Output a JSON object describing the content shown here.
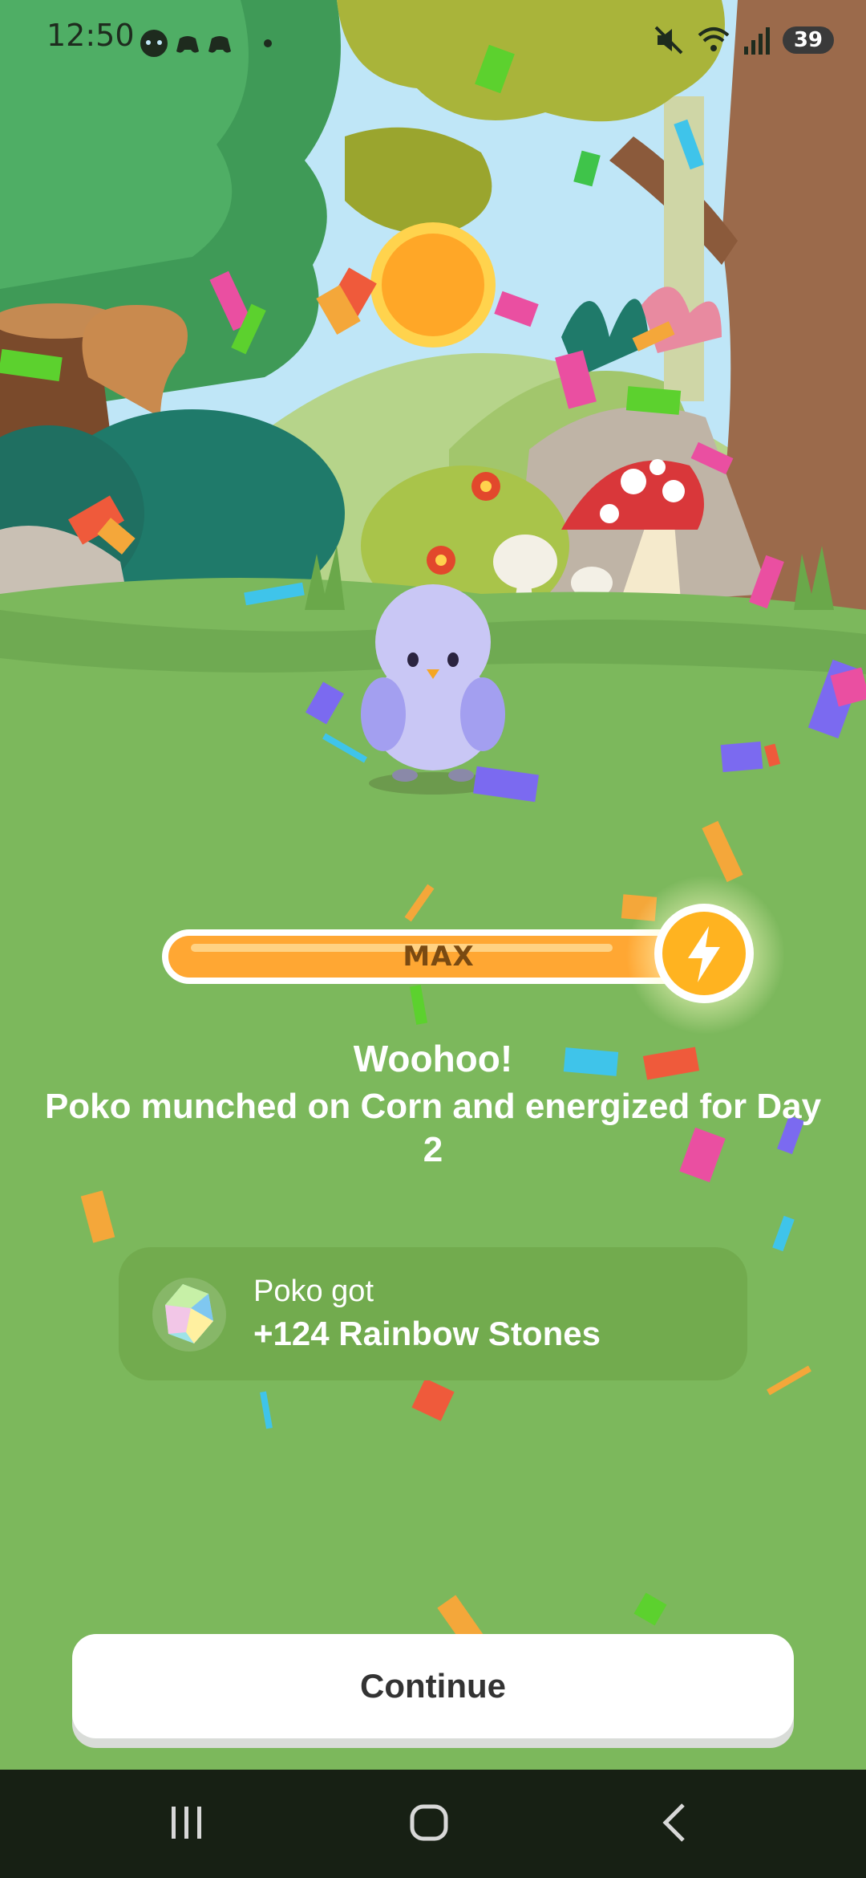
{
  "status_bar": {
    "time": "12:50",
    "battery": "39",
    "icons": [
      "game-icon",
      "gamepad-icon",
      "gamepad-icon",
      "dot-icon",
      "mute-icon",
      "wifi-icon",
      "signal-icon"
    ]
  },
  "energy": {
    "label": "MAX",
    "level": 1.0,
    "icon": "lightning-icon"
  },
  "message": {
    "headline": "Woohoo!",
    "body": "Poko munched on Corn and energized for Day 2"
  },
  "reward": {
    "title": "Poko got",
    "amount": "+124 Rainbow Stones",
    "icon": "rainbow-stone-icon"
  },
  "continue_label": "Continue",
  "nav": {
    "icons": [
      "recent-apps-icon",
      "home-icon",
      "back-icon"
    ]
  },
  "colors": {
    "grass": "#7cb85c",
    "energy_bar": "#ffa733",
    "bolt": "#ffb320",
    "reward_card": "#72ab4e",
    "navbar": "#172014"
  }
}
